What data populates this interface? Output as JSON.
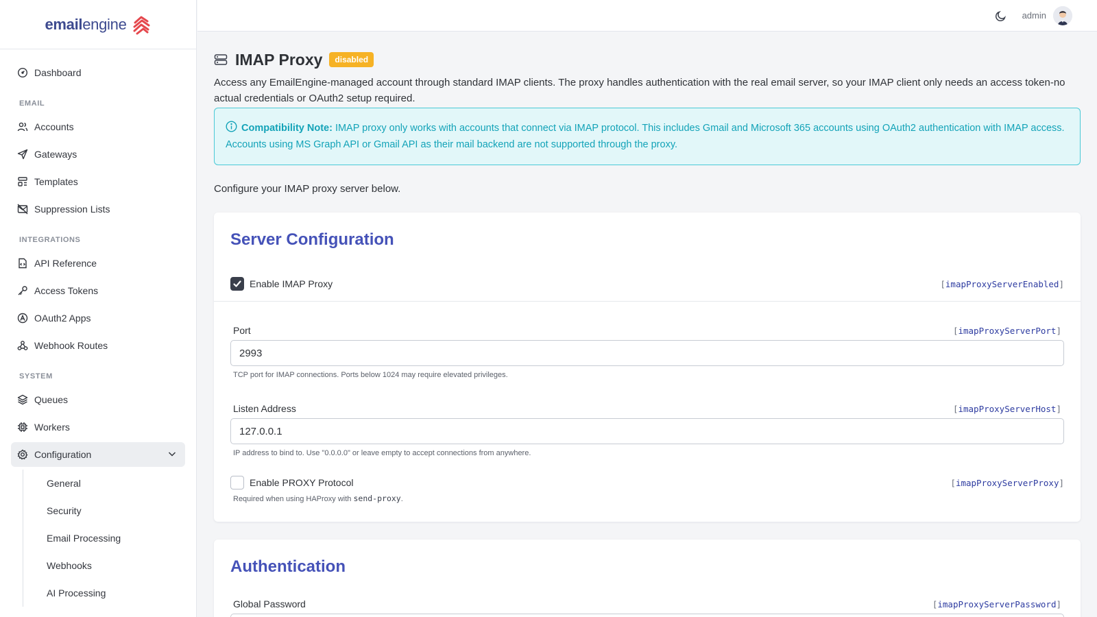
{
  "brand": {
    "name_bold": "email",
    "name_rest": "engine"
  },
  "sidebar": {
    "dashboard": "Dashboard",
    "sections": [
      {
        "heading": "EMAIL",
        "items": [
          "Accounts",
          "Gateways",
          "Templates",
          "Suppression Lists"
        ]
      },
      {
        "heading": "INTEGRATIONS",
        "items": [
          "API Reference",
          "Access Tokens",
          "OAuth2 Apps",
          "Webhook Routes"
        ]
      },
      {
        "heading": "SYSTEM",
        "items": [
          "Queues",
          "Workers",
          "Configuration"
        ]
      }
    ],
    "configuration_sub": [
      "General",
      "Security",
      "Email Processing",
      "Webhooks",
      "AI Processing"
    ]
  },
  "topbar": {
    "user": "admin"
  },
  "page": {
    "title": "IMAP Proxy",
    "status_badge": "disabled",
    "intro": "Access any EmailEngine-managed account through standard IMAP clients. The proxy handles authentication with the real email server, so your IMAP client only needs an access token-no actual credentials or OAuth2 setup required.",
    "alert_strong": "Compatibility Note:",
    "alert_text": " IMAP proxy only works with accounts that connect via IMAP protocol. This includes Gmail and Microsoft 365 accounts using OAuth2 authentication with IMAP access. Accounts using MS Graph API or Gmail API as their mail backend are not supported through the proxy.",
    "configure_text": "Configure your IMAP proxy server below."
  },
  "server_config": {
    "title": "Server Configuration",
    "enable_label": "Enable IMAP Proxy",
    "enable_checked": true,
    "enable_key": "imapProxyServerEnabled",
    "port_label": "Port",
    "port_key": "imapProxyServerPort",
    "port_value": "2993",
    "port_help": "TCP port for IMAP connections. Ports below 1024 may require elevated privileges.",
    "host_label": "Listen Address",
    "host_key": "imapProxyServerHost",
    "host_value": "127.0.0.1",
    "host_help": "IP address to bind to. Use \"0.0.0.0\" or leave empty to accept connections from anywhere.",
    "proxy_label": "Enable PROXY Protocol",
    "proxy_checked": false,
    "proxy_key": "imapProxyServerProxy",
    "proxy_help_prefix": "Required when using HAProxy with ",
    "proxy_help_code": "send-proxy",
    "proxy_help_suffix": "."
  },
  "auth": {
    "title": "Authentication",
    "password_label": "Global Password",
    "password_key": "imapProxyServerPassword"
  },
  "colors": {
    "accent": "#4552b8",
    "badge": "#f6b225",
    "alert": "#13a3b8",
    "alert_bg": "#e2f7f9"
  }
}
